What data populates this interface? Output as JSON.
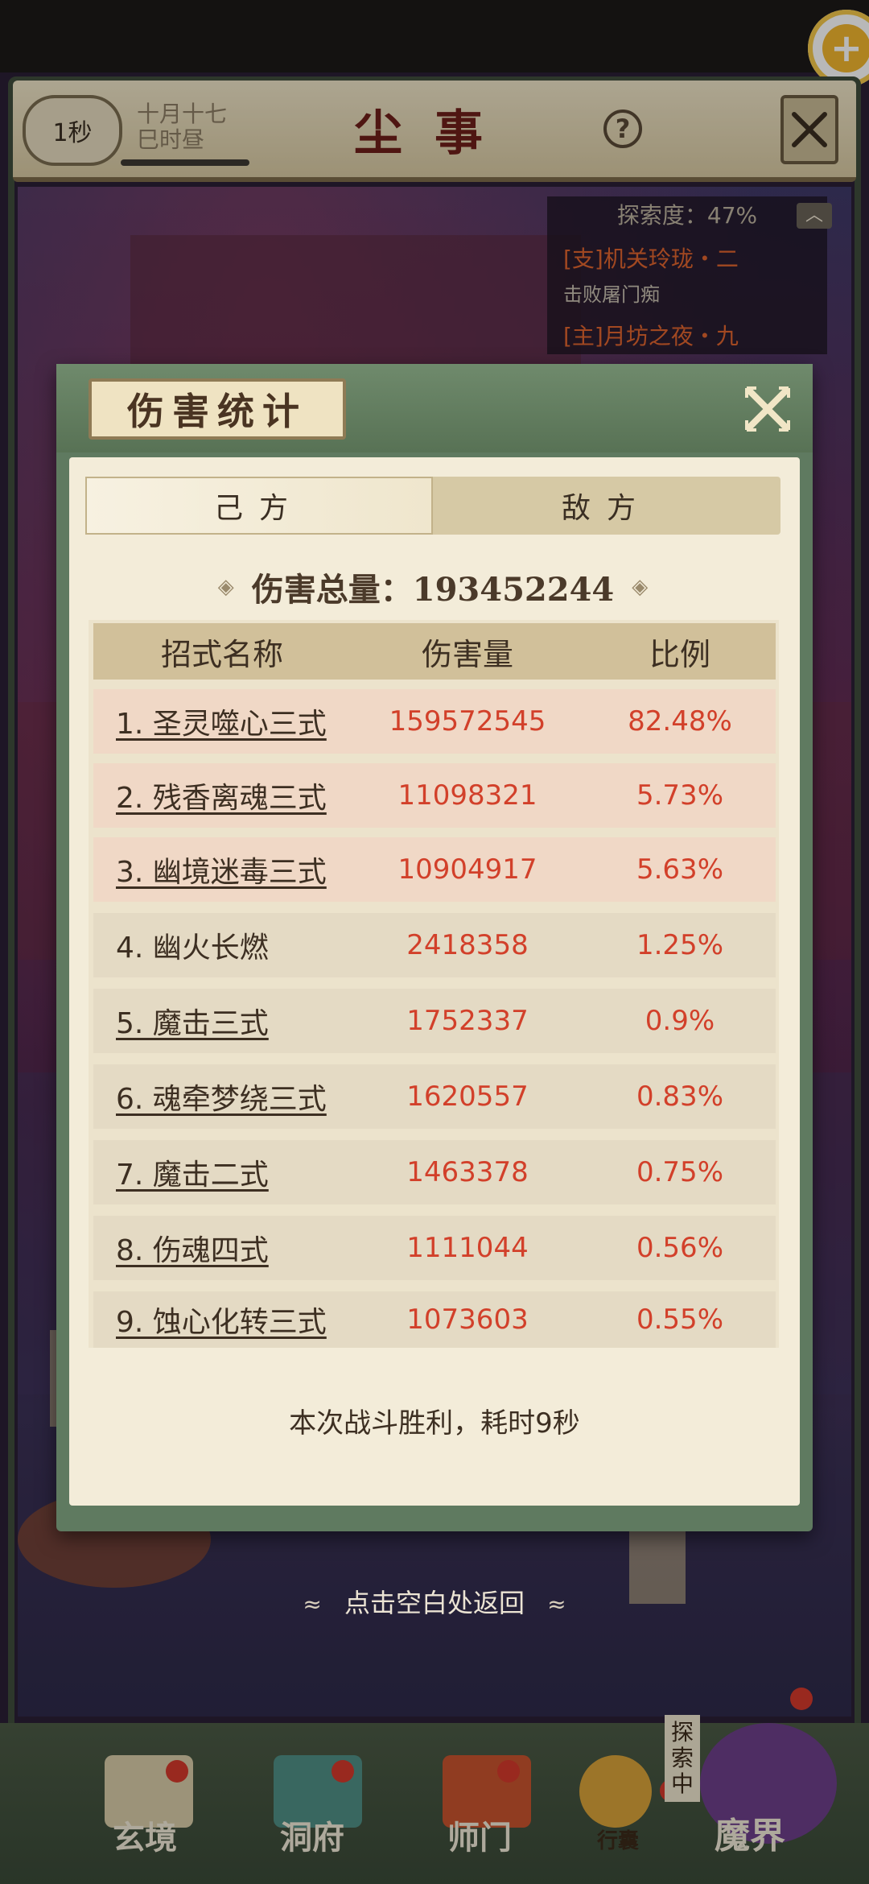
{
  "hud": {
    "timer": "1秒",
    "date_line1": "十月十七",
    "date_line2": "巳时昼",
    "title": "尘事",
    "help": "?"
  },
  "explore": {
    "label": "探索度：47%",
    "quest1": "[支]机关玲珑・二",
    "quest1_sub": "击败屠门痴",
    "quest2": "[主]月坊之夜・九"
  },
  "modal": {
    "title": "伤害统计",
    "tabs": [
      {
        "label": "己方",
        "active": true
      },
      {
        "label": "敌方",
        "active": false
      }
    ],
    "total_label": "伤害总量：193452244",
    "columns": [
      "招式名称",
      "伤害量",
      "比例"
    ],
    "rows": [
      {
        "name": "1. 圣灵噬心三式",
        "damage": "159572545",
        "ratio": "82.48%",
        "underline": true,
        "highlight": true
      },
      {
        "name": "2. 残香离魂三式",
        "damage": "11098321",
        "ratio": "5.73%",
        "underline": true,
        "highlight": true
      },
      {
        "name": "3. 幽境迷毒三式",
        "damage": "10904917",
        "ratio": "5.63%",
        "underline": true,
        "highlight": true
      },
      {
        "name": "4. 幽火长燃",
        "damage": "2418358",
        "ratio": "1.25%",
        "underline": false,
        "highlight": false
      },
      {
        "name": "5. 魔击三式",
        "damage": "1752337",
        "ratio": "0.9%",
        "underline": true,
        "highlight": false
      },
      {
        "name": "6. 魂牵梦绕三式",
        "damage": "1620557",
        "ratio": "0.83%",
        "underline": true,
        "highlight": false
      },
      {
        "name": "7. 魔击二式",
        "damage": "1463378",
        "ratio": "0.75%",
        "underline": true,
        "highlight": false
      },
      {
        "name": "8. 伤魂四式",
        "damage": "1111044",
        "ratio": "0.56%",
        "underline": true,
        "highlight": false
      },
      {
        "name": "9. 蚀心化转三式",
        "damage": "1073603",
        "ratio": "0.55%",
        "underline": true,
        "highlight": false
      }
    ],
    "footer": "本次战斗胜利，耗时9秒"
  },
  "return_hint": "点击空白处返回",
  "nav": {
    "items": [
      {
        "label": "玄境"
      },
      {
        "label": "洞府"
      },
      {
        "label": "师门"
      },
      {
        "label": "行囊"
      },
      {
        "label": "魔界"
      }
    ],
    "explore_badge": "探索中"
  },
  "colors": {
    "accent_red": "#d2402a",
    "quest_orange": "#e0642e",
    "panel_green": "#5f7a60"
  }
}
